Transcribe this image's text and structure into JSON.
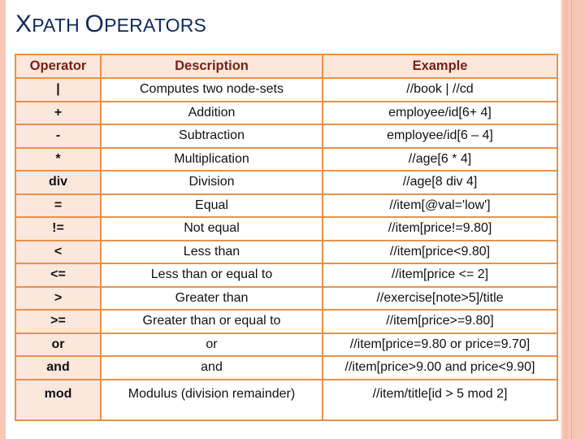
{
  "slide": {
    "title_first_letter": "X",
    "title_rest_1": "PATH ",
    "title_second_letter": "O",
    "title_rest_2": "PERATORS"
  },
  "table": {
    "headers": [
      "Operator",
      "Description",
      "Example"
    ],
    "rows": [
      {
        "operator": "|",
        "description": "Computes two node-sets",
        "example": "//book | //cd"
      },
      {
        "operator": "+",
        "description": "Addition",
        "example": "employee/id[6+ 4]"
      },
      {
        "operator": "-",
        "description": "Subtraction",
        "example": "employee/id[6 – 4]"
      },
      {
        "operator": "*",
        "description": "Multiplication",
        "example": "//age[6 * 4]"
      },
      {
        "operator": "div",
        "description": "Division",
        "example": "//age[8 div 4]"
      },
      {
        "operator": "=",
        "description": "Equal",
        "example": "//item[@val='low']"
      },
      {
        "operator": "!=",
        "description": "Not equal",
        "example": "//item[price!=9.80]"
      },
      {
        "operator": "<",
        "description": "Less than",
        "example": "//item[price<9.80]"
      },
      {
        "operator": "<=",
        "description": "Less than or equal to",
        "example": "//item[price <= 2]"
      },
      {
        "operator": ">",
        "description": "Greater than",
        "example": "//exercise[note>5]/title"
      },
      {
        "operator": ">=",
        "description": "Greater than or equal to",
        "example": "//item[price>=9.80]"
      },
      {
        "operator": "or",
        "description": "or",
        "example": "//item[price=9.80 or price=9.70]"
      },
      {
        "operator": "and",
        "description": "and",
        "example": "//item[price>9.00 and price<9.90]"
      },
      {
        "operator": "mod",
        "description": "Modulus (division remainder)",
        "example": "//item/title[id > 5 mod 2]"
      }
    ]
  },
  "colors": {
    "title": "#0f2a5a",
    "header_text": "#7a1f14",
    "border": "#e8914a",
    "operator_cell_bg": "#fce7dd",
    "accent_band": "#f7c5b3"
  }
}
